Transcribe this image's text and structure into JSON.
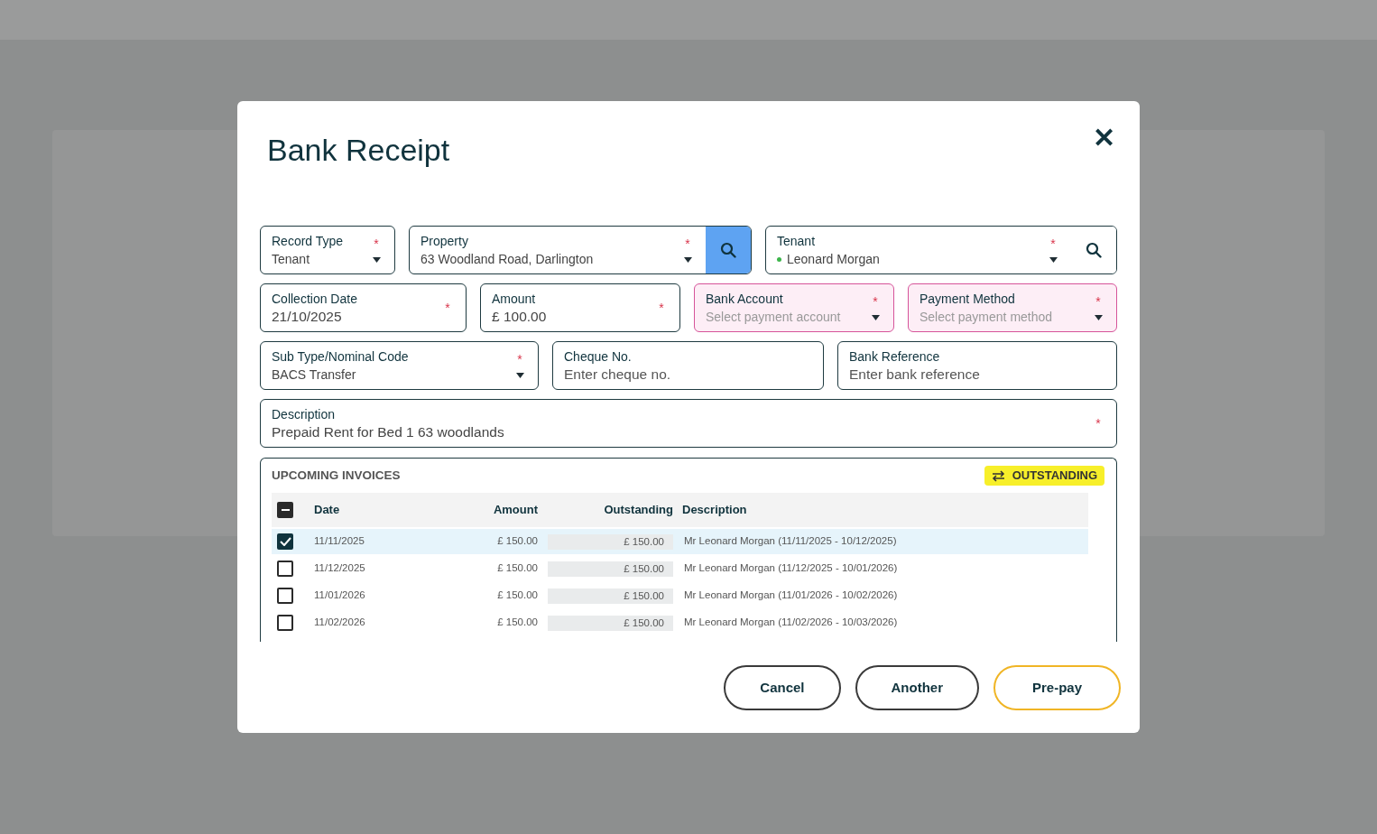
{
  "dialog": {
    "title": "Bank Receipt",
    "close": "✕"
  },
  "field_rows": [
    [
      {
        "label": "Record Type",
        "kind": "select",
        "value": "Tenant",
        "required_mark": "*",
        "invalid": false
      },
      {
        "label": "Property",
        "kind": "select",
        "value": "63 Woodland Road, Darlington",
        "required_mark": "*",
        "invalid": false,
        "search_button": true,
        "search_highlighted": true
      },
      {
        "label": "Tenant",
        "kind": "select",
        "value": "Leonard Morgan",
        "required_mark": "*",
        "invalid": false,
        "search_button": true,
        "search_highlighted": false,
        "color": "#3cb54a"
      }
    ],
    [
      {
        "label": "Collection Date",
        "kind": "text",
        "value": "21/10/2025",
        "required_mark": "*",
        "invalid": false
      },
      {
        "label": "Amount",
        "kind": "text",
        "value": "£ 100.00",
        "required_mark": "*",
        "invalid": false
      },
      {
        "label": "Bank Account",
        "kind": "select",
        "placeholder": "Select payment account",
        "required_mark": "*",
        "invalid": true
      },
      {
        "label": "Payment Method",
        "kind": "select",
        "placeholder": "Select payment method",
        "required_mark": "*",
        "invalid": true
      }
    ],
    [
      {
        "label": "Sub Type/Nominal Code",
        "kind": "select",
        "value": "BACS Transfer",
        "required_mark": "*",
        "invalid": false
      },
      {
        "label": "Cheque No.",
        "kind": "text",
        "placeholder": "Enter cheque no.",
        "invalid": false
      },
      {
        "label": "Bank Reference",
        "kind": "text",
        "placeholder": "Enter bank reference",
        "invalid": false
      }
    ],
    [
      {
        "label": "Description",
        "kind": "text",
        "value": "Prepaid Rent for Bed 1 63 woodlands",
        "required_mark": "*",
        "invalid": false
      }
    ]
  ],
  "invoices": {
    "title": "UPCOMING INVOICES",
    "filter": "OUTSTANDING",
    "select_all": {
      "indeterminate": true
    },
    "columns": [
      "Date",
      "Amount",
      "Outstanding",
      "Description"
    ],
    "rows": [
      {
        "date": "11/11/2025",
        "amount": "£ 150.00",
        "outstanding": "£ 150.00",
        "description": "Mr Leonard Morgan (11/11/2025 - 10/12/2025)",
        "checked": true
      },
      {
        "date": "11/12/2025",
        "amount": "£ 150.00",
        "outstanding": "£ 150.00",
        "description": "Mr Leonard Morgan (11/12/2025 - 10/01/2026)",
        "checked": false
      },
      {
        "date": "11/01/2026",
        "amount": "£ 150.00",
        "outstanding": "£ 150.00",
        "description": "Mr Leonard Morgan (11/01/2026 - 10/02/2026)",
        "checked": false
      },
      {
        "date": "11/02/2026",
        "amount": "£ 150.00",
        "outstanding": "£ 150.00",
        "description": "Mr Leonard Morgan (11/02/2026 - 10/03/2026)",
        "checked": false
      }
    ]
  },
  "buttons": [
    {
      "label": "Cancel",
      "kind": "secondary"
    },
    {
      "label": "Another",
      "kind": "secondary"
    },
    {
      "label": "Pre-pay",
      "kind": "primary"
    }
  ]
}
